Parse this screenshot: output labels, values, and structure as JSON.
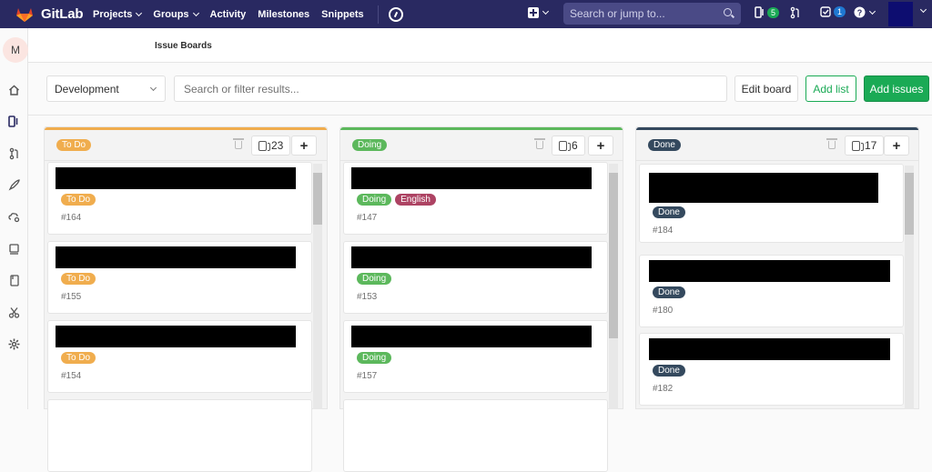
{
  "topbar": {
    "brand": "GitLab",
    "nav": [
      "Projects",
      "Groups",
      "Activity",
      "Milestones",
      "Snippets"
    ],
    "search_placeholder": "Search or jump to...",
    "mr_count": "5",
    "todo_count": "1"
  },
  "sidebar": {
    "avatar_letter": "M"
  },
  "breadcrumb": "Issue Boards",
  "filter": {
    "board_select": "Development",
    "placeholder": "Search or filter results...",
    "edit_board": "Edit board",
    "add_list": "Add list",
    "add_issues": "Add issues"
  },
  "colors": {
    "todo": "#f0ad4e",
    "doing": "#5cb85c",
    "done": "#34495e",
    "english": "#ad4363",
    "add_issues": "#1aaa55"
  },
  "boards": [
    {
      "label": "To Do",
      "count": "23",
      "cards": [
        {
          "labels": [
            "To Do"
          ],
          "num": "#164"
        },
        {
          "labels": [
            "To Do"
          ],
          "num": "#155"
        },
        {
          "labels": [
            "To Do"
          ],
          "num": "#154"
        }
      ]
    },
    {
      "label": "Doing",
      "count": "6",
      "cards": [
        {
          "labels": [
            "Doing",
            "English"
          ],
          "num": "#147"
        },
        {
          "labels": [
            "Doing"
          ],
          "num": "#153"
        },
        {
          "labels": [
            "Doing"
          ],
          "num": "#157"
        }
      ]
    },
    {
      "label": "Done",
      "count": "17",
      "cards": [
        {
          "labels": [
            "Done"
          ],
          "num": "#184"
        },
        {
          "labels": [
            "Done"
          ],
          "num": "#180"
        },
        {
          "labels": [
            "Done"
          ],
          "num": "#182"
        }
      ]
    }
  ]
}
